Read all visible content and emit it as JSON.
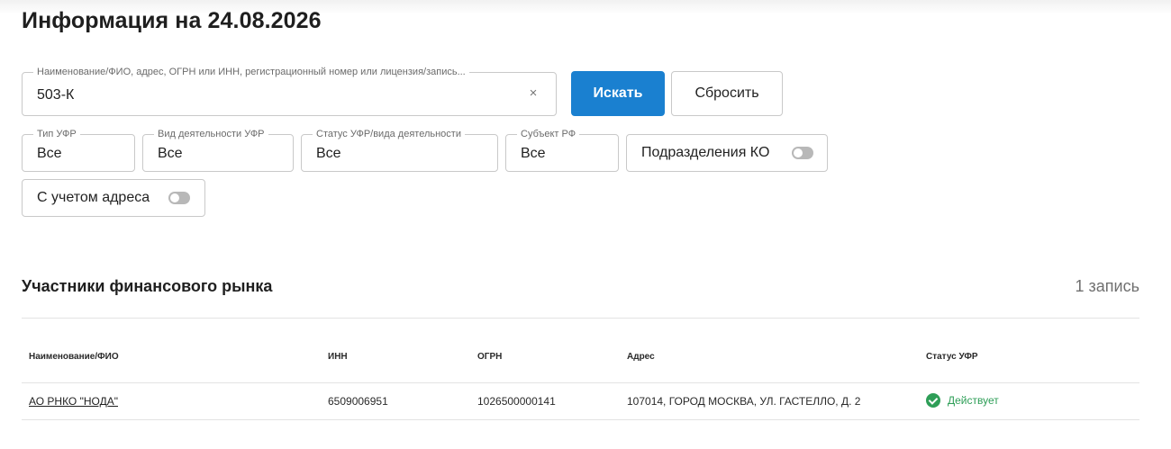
{
  "page": {
    "title": "Информация на 24.08.2026"
  },
  "search": {
    "legend": "Наименование/ФИО, адрес, ОГРН или ИНН, регистрационный номер или лицензия/запись...",
    "value": "503-К",
    "clear_icon": "×",
    "search_button": "Искать",
    "reset_button": "Сбросить"
  },
  "filters": {
    "type": {
      "legend": "Тип УФР",
      "value": "Все"
    },
    "activity": {
      "legend": "Вид деятельности УФР",
      "value": "Все"
    },
    "status": {
      "legend": "Статус УФР/вида деятельности",
      "value": "Все"
    },
    "subject": {
      "legend": "Субъект РФ",
      "value": "Все"
    },
    "divisions_toggle": {
      "label": "Подразделения КО",
      "on": false
    },
    "address_toggle": {
      "label": "С учетом адреса",
      "on": false
    }
  },
  "results": {
    "title": "Участники финансового рынка",
    "count": "1 запись",
    "columns": [
      "Наименование/ФИО",
      "ИНН",
      "ОГРН",
      "Адрес",
      "Статус УФР"
    ],
    "rows": [
      {
        "name": "АО РНКО \"НОДА\"",
        "inn": "6509006951",
        "ogrn": "1026500000141",
        "address": "107014, ГОРОД МОСКВА, УЛ. ГАСТЕЛЛО, Д. 2",
        "status": "Действует",
        "status_icon": "check-circle-icon"
      }
    ]
  },
  "colors": {
    "accent": "#1a80d0",
    "status_ok": "#2e9e57"
  }
}
